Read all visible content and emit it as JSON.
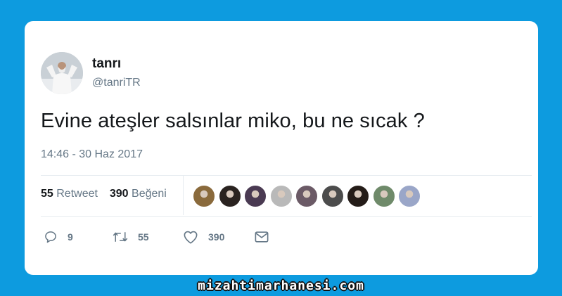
{
  "tweet": {
    "name": "tanrı",
    "handle": "@tanriTR",
    "text": "Evine ateşler salsınlar miko, bu ne sıcak ?",
    "timestamp": "14:46 - 30 Haz 2017"
  },
  "stats": {
    "retweets": {
      "count": "55",
      "label": "Retweet"
    },
    "likes": {
      "count": "390",
      "label": "Beğeni"
    }
  },
  "likers": [
    {
      "icon": "liker-avatar-1",
      "color": "#8a6a3c"
    },
    {
      "icon": "liker-avatar-2",
      "color": "#2a2320"
    },
    {
      "icon": "liker-avatar-3",
      "color": "#4a3a52"
    },
    {
      "icon": "liker-avatar-4",
      "color": "#b9b9b9"
    },
    {
      "icon": "liker-avatar-5",
      "color": "#6b5a66"
    },
    {
      "icon": "liker-avatar-6",
      "color": "#4c4c4c"
    },
    {
      "icon": "liker-avatar-7",
      "color": "#241c18"
    },
    {
      "icon": "liker-avatar-8",
      "color": "#6f8a6a"
    },
    {
      "icon": "liker-avatar-9",
      "color": "#9aa6c8"
    }
  ],
  "actions": {
    "reply": {
      "icon": "reply-icon",
      "count": "9"
    },
    "retweet": {
      "icon": "retweet-icon",
      "count": "55"
    },
    "like": {
      "icon": "heart-icon",
      "count": "390"
    },
    "message": {
      "icon": "envelope-icon"
    }
  },
  "watermark": "mizahtimarhanesi.com",
  "colors": {
    "background": "#0d9bdf",
    "card": "#ffffff",
    "text": "#14171a",
    "muted": "#657786",
    "divider": "#e6ecf0"
  }
}
